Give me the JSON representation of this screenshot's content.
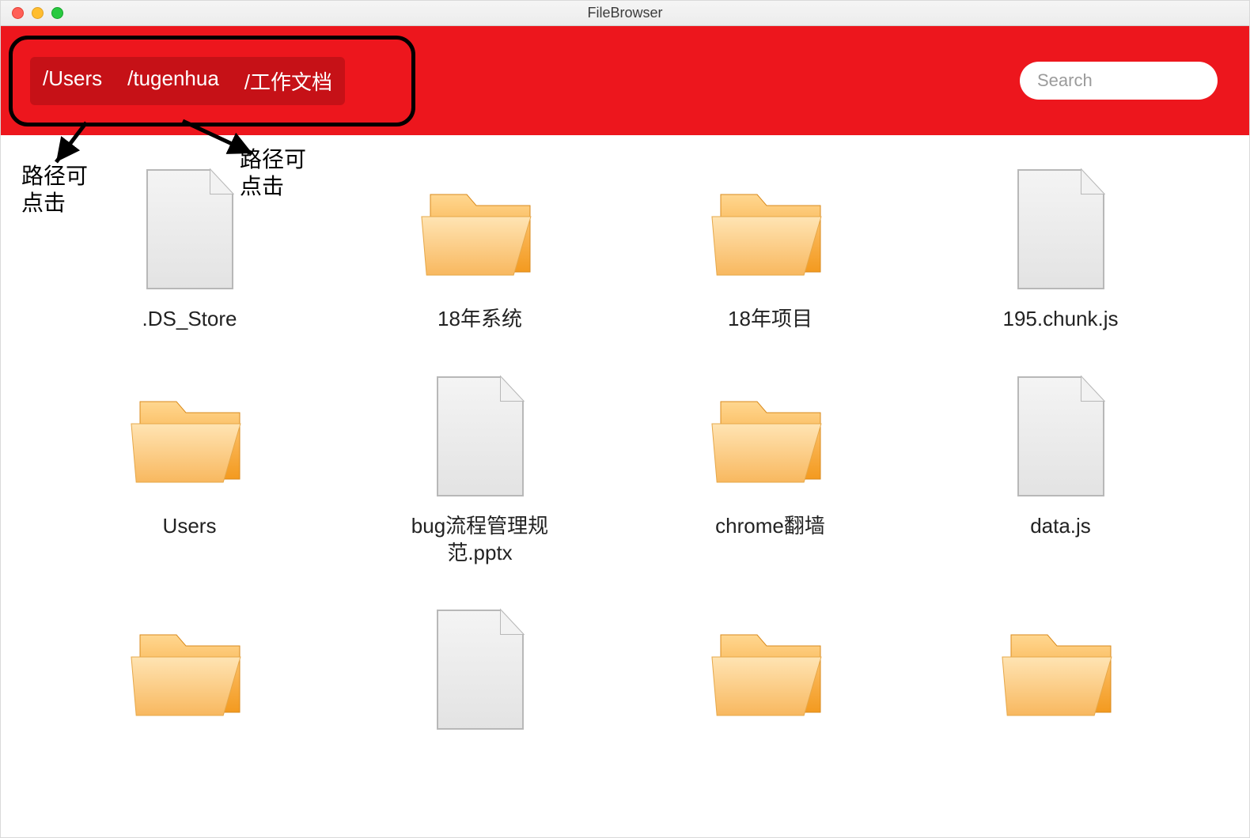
{
  "window": {
    "title": "FileBrowser"
  },
  "path": {
    "segments": [
      "/Users",
      "/tugenhua",
      "/工作文档"
    ]
  },
  "search": {
    "placeholder": "Search"
  },
  "annotations": {
    "note1": "路径可点击",
    "note2": "路径可点击"
  },
  "items": [
    {
      "name": ".DS_Store",
      "type": "file"
    },
    {
      "name": "18年系统",
      "type": "folder"
    },
    {
      "name": "18年项目",
      "type": "folder"
    },
    {
      "name": "195.chunk.js",
      "type": "file"
    },
    {
      "name": "Users",
      "type": "folder"
    },
    {
      "name": "bug流程管理规范.pptx",
      "type": "file"
    },
    {
      "name": "chrome翻墙",
      "type": "folder"
    },
    {
      "name": "data.js",
      "type": "file"
    },
    {
      "name": "",
      "type": "folder"
    },
    {
      "name": "",
      "type": "file"
    },
    {
      "name": "",
      "type": "folder"
    },
    {
      "name": "",
      "type": "folder"
    }
  ]
}
